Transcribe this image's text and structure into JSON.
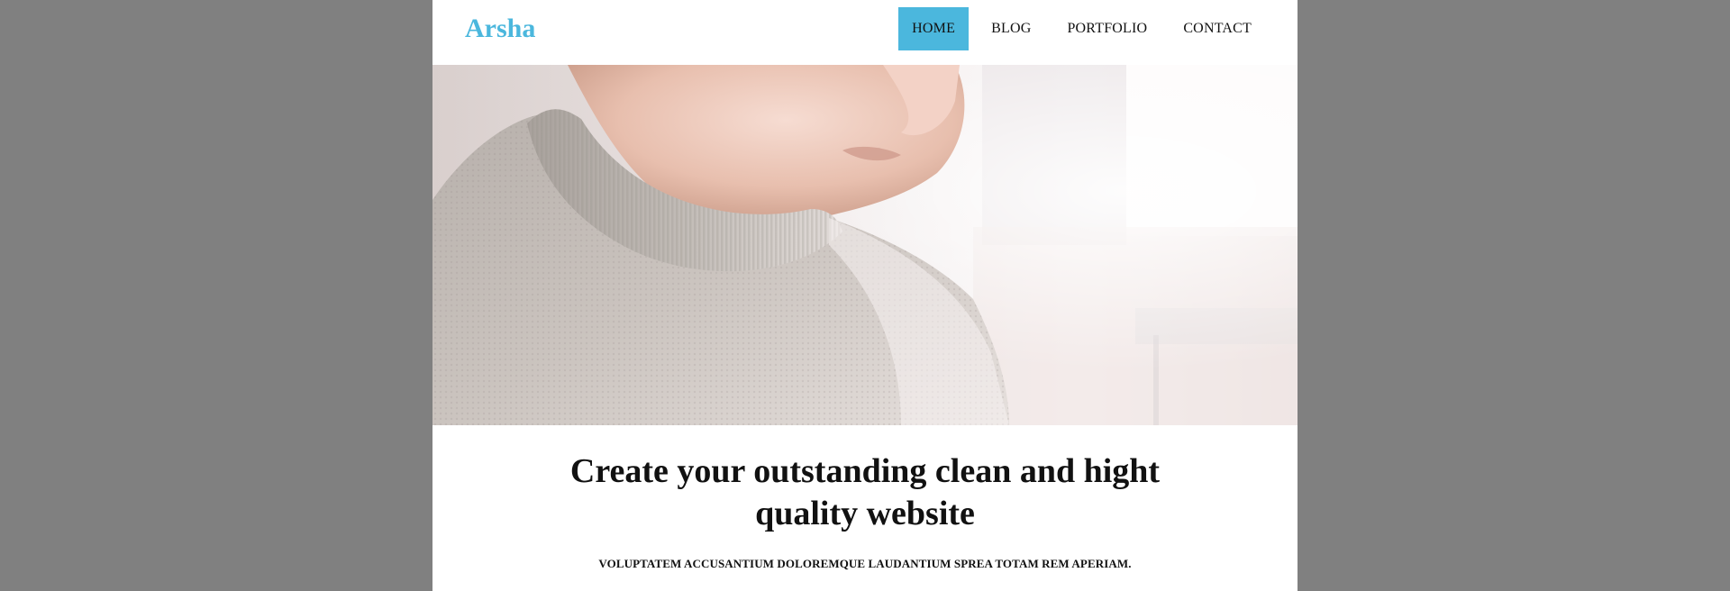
{
  "header": {
    "logo": "Arsha",
    "nav": [
      {
        "label": "HOME",
        "active": true
      },
      {
        "label": "BLOG",
        "active": false
      },
      {
        "label": "PORTFOLIO",
        "active": false
      },
      {
        "label": "CONTACT",
        "active": false
      }
    ]
  },
  "hero": {
    "image": "woman-in-knit-sweater-photo"
  },
  "main": {
    "headline": "Create your outstanding clean and hight quality website",
    "subheadline": "VOLUPTATEM ACCUSANTIUM DOLOREMQUE LAUDANTIUM SPREA TOTAM REM APERIAM."
  },
  "colors": {
    "accent": "#4bb7dd",
    "background": "#808080",
    "page": "#ffffff",
    "text": "#111111"
  }
}
